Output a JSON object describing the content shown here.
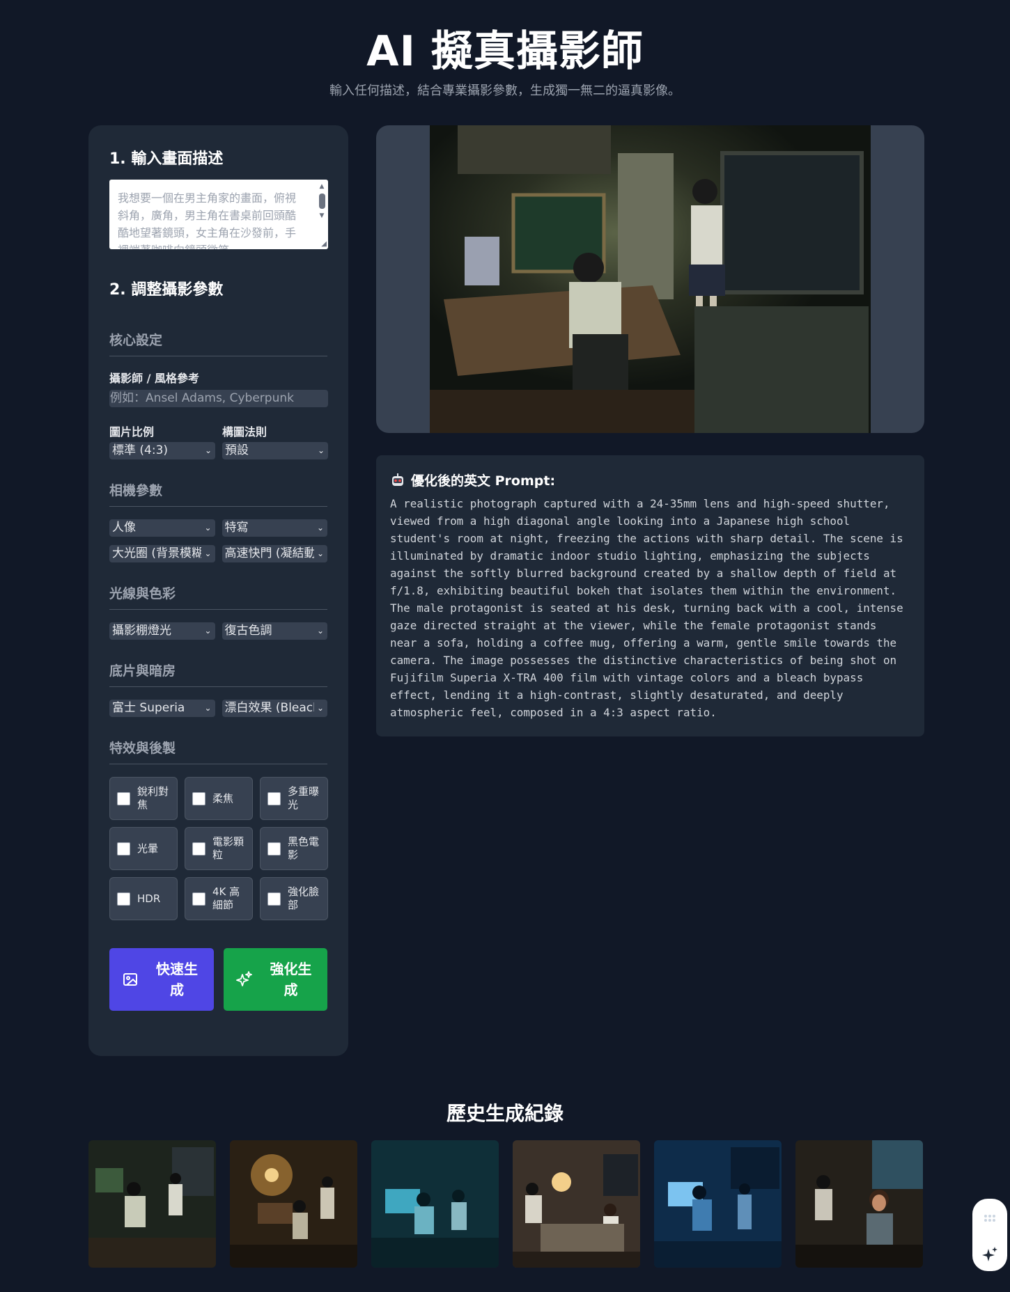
{
  "header": {
    "title": "AI 擬真攝影師",
    "subtitle": "輸入任何描述，結合專業攝影參數，生成獨一無二的逼真影像。"
  },
  "step1": {
    "title": "1. 輸入畫面描述",
    "placeholder": "我想要一個在男主角家的畫面，俯視斜角，廣角，男主角在書桌前回頭酷酷地望著鏡頭，女主角在沙發前，手裡端著咖啡向鏡頭微笑"
  },
  "step2": {
    "title": "2. 調整攝影參數"
  },
  "core": {
    "section": "核心設定",
    "photographer_label": "攝影師 / 風格參考",
    "photographer_placeholder": "例如：Ansel Adams, Cyberpunk",
    "ratio_label": "圖片比例",
    "ratio_value": "標準 (4:3)",
    "composition_label": "構圖法則",
    "composition_value": "預設"
  },
  "camera": {
    "section": "相機參數",
    "mode": "人像",
    "shot": "特寫",
    "aperture": "大光圈 (背景模糊)",
    "shutter": "高速快門 (凝結動作)"
  },
  "light": {
    "section": "光線與色彩",
    "lighting": "攝影棚燈光",
    "tone": "復古色調"
  },
  "film": {
    "section": "底片與暗房",
    "stock": "富士 Superia",
    "process": "漂白效果 (Bleach Bypass)"
  },
  "effects": {
    "section": "特效與後製",
    "items": [
      "銳利對焦",
      "柔焦",
      "多重曝光",
      "光暈",
      "電影顆粒",
      "黑色電影",
      "HDR",
      "4K 高細節",
      "強化臉部"
    ]
  },
  "buttons": {
    "quick": "快速生成",
    "enhanced": "強化生成"
  },
  "prompt": {
    "title": "優化後的英文 Prompt:",
    "text": "A realistic photograph captured with a 24-35mm lens and high-speed shutter,\nviewed from a high diagonal angle looking into a Japanese high school\nstudent's room at night, freezing the actions with sharp detail. The scene is\nilluminated by dramatic indoor studio lighting, emphasizing the subjects\nagainst the softly blurred background created by a shallow depth of field at\nf/1.8, exhibiting beautiful bokeh that isolates them within the environment.\nThe male protagonist is seated at his desk, turning back with a cool, intense\ngaze directed straight at the viewer, while the female protagonist stands\nnear a sofa, holding a coffee mug, offering a warm, gentle smile towards the\ncamera. The image possesses the distinctive characteristics of being shot on\nFujifilm Superia X-TRA 400 film with vintage colors and a bleach bypass\neffect, lending it a high-contrast, slightly desaturated, and deeply\natmospheric feel, composed in a 4:3 aspect ratio."
  },
  "history": {
    "title": "歷史生成紀錄"
  },
  "colors": {
    "background": "#111827",
    "panel": "#1f2937",
    "quick_button": "#4f46e5",
    "enhanced_button": "#16a34a"
  },
  "icons": {
    "quick_button": "image-icon",
    "enhanced_button": "sparkles-icon",
    "prompt": "robot-icon",
    "fab": "sparkle-icon"
  }
}
